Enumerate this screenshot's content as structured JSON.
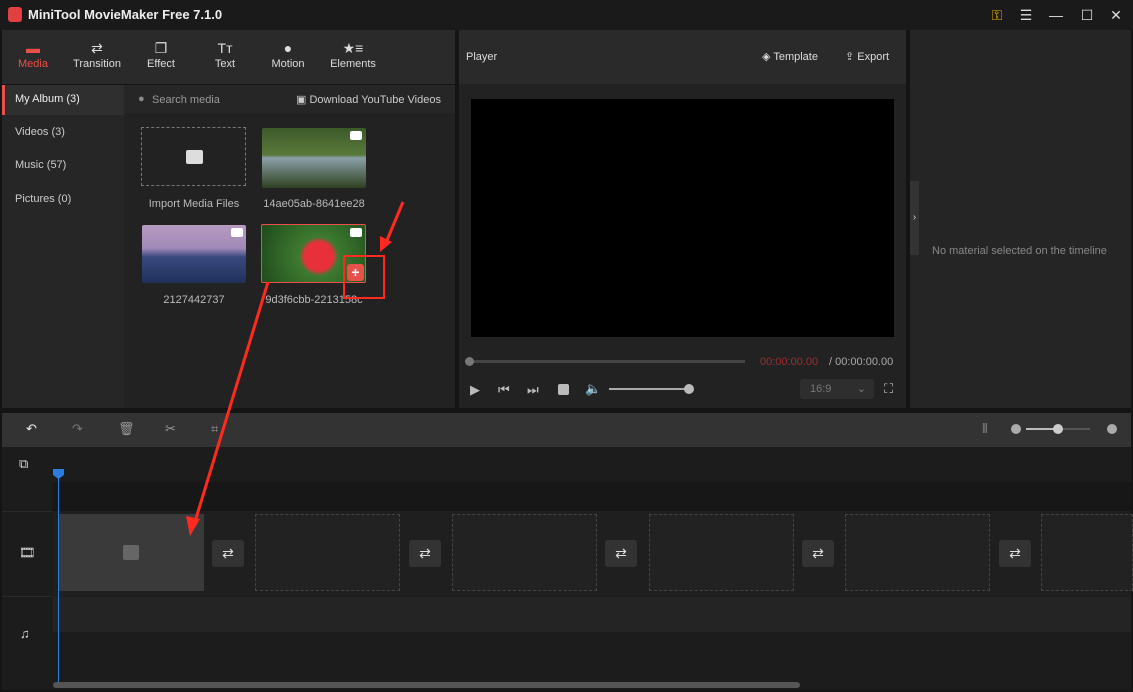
{
  "window": {
    "title": "MiniTool MovieMaker Free 7.1.0",
    "controls": [
      "key-icon",
      "menu-icon",
      "minimize-icon",
      "maximize-icon",
      "close-icon"
    ]
  },
  "toolbar": {
    "tabs": [
      {
        "label": "Media",
        "icon": "folder-icon",
        "active": true
      },
      {
        "label": "Transition",
        "icon": "swap-icon"
      },
      {
        "label": "Effect",
        "icon": "layers-icon"
      },
      {
        "label": "Text",
        "icon": "text-icon"
      },
      {
        "label": "Motion",
        "icon": "motion-icon"
      },
      {
        "label": "Elements",
        "icon": "elements-icon"
      }
    ]
  },
  "sidebar": {
    "items": [
      {
        "label": "My Album (3)",
        "active": true
      },
      {
        "label": "Videos (3)"
      },
      {
        "label": "Music (57)"
      },
      {
        "label": "Pictures (0)"
      }
    ]
  },
  "media": {
    "search_placeholder": "Search media",
    "download_label": "Download YouTube Videos",
    "import_label": "Import Media Files",
    "items": [
      {
        "name": "14ae05ab-8641ee28"
      },
      {
        "name": "2127442737"
      },
      {
        "name": "9d3f6cbb-2213158c"
      }
    ]
  },
  "player": {
    "title": "Player",
    "template_label": "Template",
    "export_label": "Export",
    "current_time": "00:00:00.00",
    "total_time": "/ 00:00:00.00",
    "aspect_ratio": "16:9",
    "progress": 0,
    "volume": 1.0
  },
  "properties": {
    "empty_message": "No material selected on the timeline"
  },
  "timeline": {
    "zoom_level": 0.5
  },
  "colors": {
    "accent": "#e8504a",
    "playhead": "#2a7de1",
    "annotation": "#ff2a1f"
  }
}
